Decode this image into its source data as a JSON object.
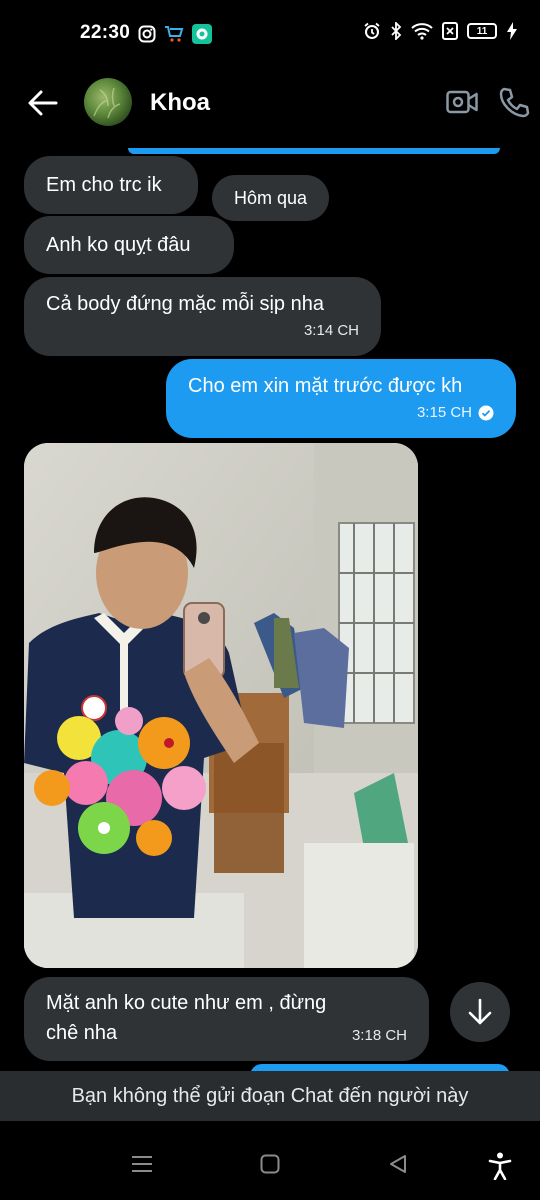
{
  "status_bar": {
    "time": "22:30",
    "battery": "11"
  },
  "header": {
    "contact_name": "Khoa"
  },
  "messages": [
    {
      "text": "Em cho trc ik"
    },
    {
      "text": "Anh ko quỵt đâu"
    },
    {
      "text": "Cả body đứng mặc mỗi sịp nha",
      "time": "3:14 CH"
    },
    {
      "text": "Cho em xin mặt trước được kh",
      "time": "3:15 CH"
    },
    {
      "text": "Mặt anh ko cute như em , đừng chê nha",
      "time": "3:18 CH"
    }
  ],
  "date_pill": "Hôm qua",
  "blocked_notice": "Bạn không thể gửi đoạn Chat đến người này",
  "colors": {
    "accent": "#1d9bf0",
    "incoming_bubble": "#2f3336",
    "background": "#000000"
  }
}
